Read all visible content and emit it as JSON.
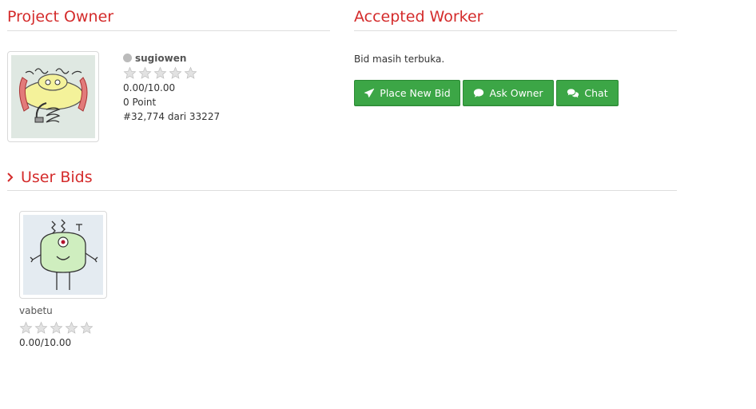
{
  "colors": {
    "accent": "#d42b2b",
    "button_green": "#3ca646",
    "rule": "#dddddd",
    "star_empty": "#d7d7d7"
  },
  "project_owner": {
    "title": "Project Owner",
    "username": "sugiowen",
    "status_icon": "offline-dot-icon",
    "rating_stars": 0,
    "rating_text": "0.00/10.00",
    "points": "0 Point",
    "rank": "#32,774 dari 33227"
  },
  "accepted_worker": {
    "title": "Accepted Worker",
    "status_text": "Bid masih terbuka.",
    "buttons": [
      {
        "label": "Place New Bid",
        "icon": "paper-plane-icon"
      },
      {
        "label": "Ask Owner",
        "icon": "comment-icon"
      },
      {
        "label": "Chat",
        "icon": "comments-icon"
      }
    ]
  },
  "user_bids": {
    "title": "User Bids",
    "chevron_icon": "chevron-right-icon",
    "bids": [
      {
        "username": "vabetu",
        "rating_stars": 0,
        "rating_text": "0.00/10.00"
      }
    ]
  }
}
